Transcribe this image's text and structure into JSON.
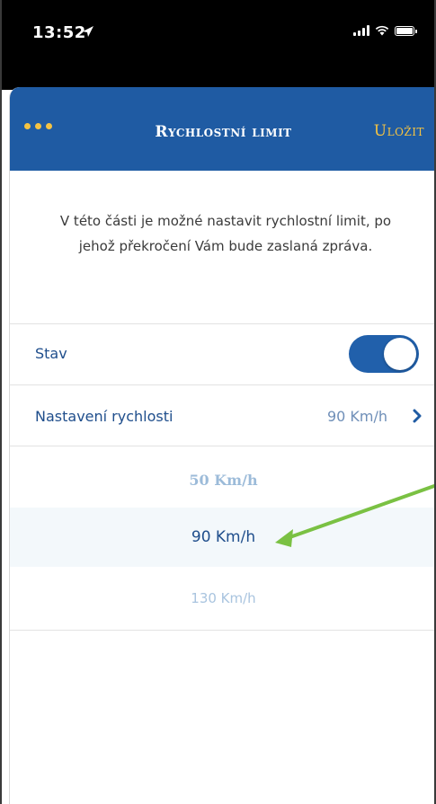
{
  "status_bar": {
    "time": "13:52",
    "location_icon": "location-arrow-icon",
    "signal_icon": "cellular-signal-icon",
    "wifi_icon": "wifi-icon",
    "battery_icon": "battery-icon"
  },
  "nav": {
    "menu_icon": "more-dots-icon",
    "title": "Rychlostní limit",
    "save_label": "Uložit",
    "bar_color": "#1f5ba3",
    "accent_color": "#f5c342"
  },
  "description": "V této části je možné nastavit rychlostní limit, po jehož překročení Vám bude zaslaná zpráva.",
  "rows": {
    "status_label": "Stav",
    "status_on": true,
    "speed_label": "Nastavení rychlosti",
    "speed_value": "90 Km/h",
    "speed_chevron": "chevron-right-icon"
  },
  "picker": {
    "options": [
      "50 Km/h",
      "90 Km/h",
      "130 Km/h"
    ],
    "selected": "90 Km/h"
  },
  "annotation": {
    "arrow_color": "#7ac143",
    "arrow_icon": "green-pointer-arrow"
  }
}
